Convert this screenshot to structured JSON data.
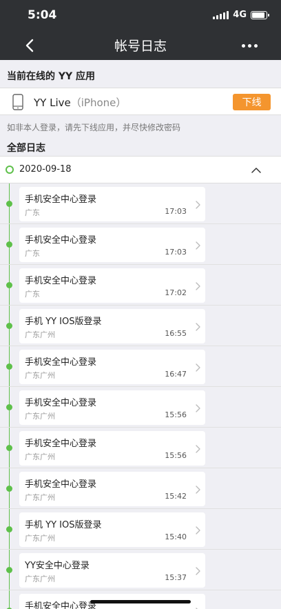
{
  "status_bar": {
    "time": "5:04",
    "network": "4G",
    "battery_level": 0.9
  },
  "nav": {
    "title": "帐号日志",
    "back_icon": "chevron-left-icon",
    "more_icon": "more-dots-icon"
  },
  "online_section": {
    "title": "当前在线的 YY 应用",
    "app": {
      "name": "YY Live",
      "device": "（iPhone）",
      "icon": "phone-icon"
    },
    "offline_label": "下线",
    "hint": "如非本人登录，请先下线应用，并尽快修改密码"
  },
  "log_section": {
    "title": "全部日志",
    "date": "2020-09-18",
    "entries": [
      {
        "title": "手机安全中心登录",
        "location": "广东",
        "time": "17:03"
      },
      {
        "title": "手机安全中心登录",
        "location": "广东",
        "time": "17:03"
      },
      {
        "title": "手机安全中心登录",
        "location": "广东",
        "time": "17:02"
      },
      {
        "title": "手机 YY IOS版登录",
        "location": "广东广州",
        "time": "16:55"
      },
      {
        "title": "手机安全中心登录",
        "location": "广东广州",
        "time": "16:47"
      },
      {
        "title": "手机安全中心登录",
        "location": "广东广州",
        "time": "15:56"
      },
      {
        "title": "手机安全中心登录",
        "location": "广东广州",
        "time": "15:56"
      },
      {
        "title": "手机安全中心登录",
        "location": "广东广州",
        "time": "15:42"
      },
      {
        "title": "手机 YY IOS版登录",
        "location": "广东广州",
        "time": "15:40"
      },
      {
        "title": "YY安全中心登录",
        "location": "广东广州",
        "time": "15:37"
      },
      {
        "title": "手机安全中心登录",
        "location": "",
        "time": ""
      }
    ]
  },
  "colors": {
    "nav_bg": "#2f3134",
    "accent_orange": "#f4952e",
    "timeline_green": "#5ec04a"
  }
}
